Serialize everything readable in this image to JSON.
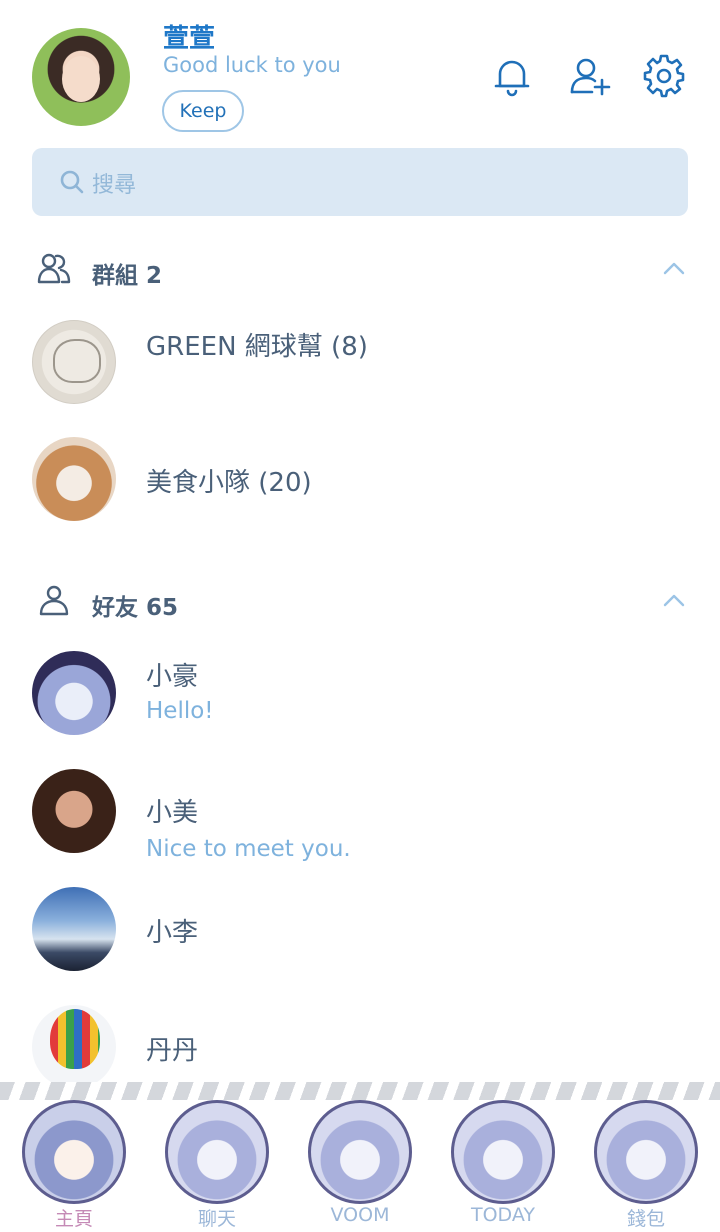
{
  "profile": {
    "name": "萱萱",
    "status": "Good luck to you",
    "keep_label": "Keep"
  },
  "header_icons": [
    "bell-icon",
    "add-friend-icon",
    "gear-icon"
  ],
  "search": {
    "placeholder": "搜尋"
  },
  "groups": {
    "title": "群組 2",
    "items": [
      {
        "name": "GREEN 網球幫 (8)"
      },
      {
        "name": "美食小隊 (20)"
      }
    ]
  },
  "friends": {
    "title": "好友 65",
    "items": [
      {
        "name": "小豪",
        "message": "Hello!"
      },
      {
        "name": "小美",
        "message": "Nice to meet you."
      },
      {
        "name": "小李",
        "message": ""
      },
      {
        "name": "丹丹",
        "message": ""
      }
    ]
  },
  "nav": {
    "items": [
      {
        "label": "主頁",
        "active": true
      },
      {
        "label": "聊天",
        "active": false
      },
      {
        "label": "VOOM",
        "active": false
      },
      {
        "label": "TODAY",
        "active": false
      },
      {
        "label": "錢包",
        "active": false
      }
    ]
  },
  "colors": {
    "accent": "#1f78c8",
    "status_text": "#7eb2dd",
    "search_bg": "#dbe8f4",
    "nav_active": "#c58ab6"
  }
}
